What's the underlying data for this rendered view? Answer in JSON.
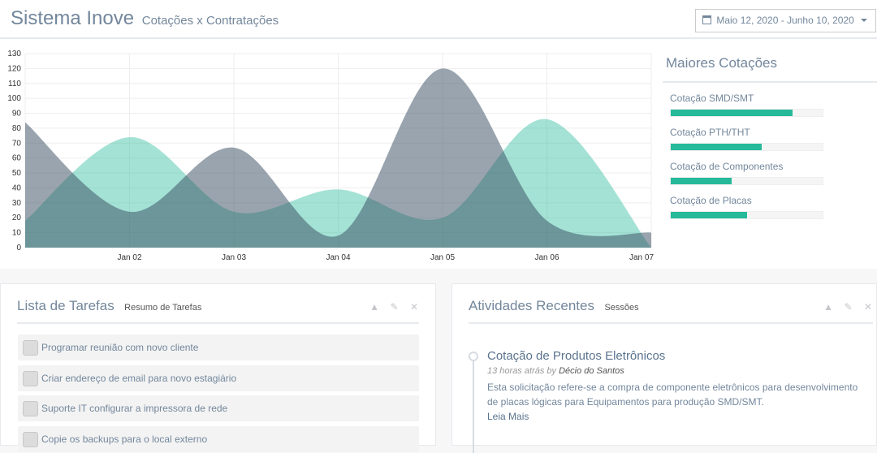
{
  "header": {
    "title": "Sistema Inove",
    "subtitle": "Cotações x Contratações",
    "daterange": "Maio 12, 2020 - Junho 10, 2020",
    "calendar_icon": "calendar-icon",
    "caret_icon": "caret-down-icon"
  },
  "chart_data": {
    "type": "area",
    "xlabels": [
      "Jan 02",
      "Jan 03",
      "Jan 04",
      "Jan 05",
      "Jan 06",
      "Jan 07"
    ],
    "ylim": [
      0,
      130
    ],
    "yticks": [
      0,
      10,
      20,
      30,
      40,
      50,
      60,
      70,
      80,
      90,
      100,
      110,
      120,
      130
    ],
    "grid": true,
    "series": [
      {
        "color": "#26b99a",
        "points": [
          [
            1,
            18
          ],
          [
            2,
            74
          ],
          [
            3,
            24
          ],
          [
            4,
            39
          ],
          [
            5,
            20
          ],
          [
            6,
            86
          ],
          [
            7,
            0
          ]
        ]
      },
      {
        "color": "#34495e",
        "points": [
          [
            1,
            84
          ],
          [
            2,
            24
          ],
          [
            3,
            67
          ],
          [
            4,
            8
          ],
          [
            5,
            120
          ],
          [
            6,
            18
          ],
          [
            7,
            10
          ]
        ]
      }
    ]
  },
  "sidebar": {
    "title": "Maiores Cotações",
    "items": [
      {
        "label": "Cotação SMD/SMT",
        "value": 80
      },
      {
        "label": "Cotação PTH/THT",
        "value": 60
      },
      {
        "label": "Cotação de Componentes",
        "value": 40
      },
      {
        "label": "Cotação de Placas",
        "value": 50
      }
    ]
  },
  "tasks": {
    "title": "Lista de Tarefas",
    "subtitle": "Resumo de Tarefas",
    "items": [
      "Programar reunião com novo cliente",
      "Criar endereço de email para novo estagiário",
      "Suporte IT configurar a impressora de rede",
      "Copie os backups para o local externo"
    ]
  },
  "activities": {
    "title": "Atividades Recentes",
    "subtitle": "Sessões",
    "item": {
      "title": "Cotação de Produtos Eletrônicos",
      "time": "13 horas atrás by",
      "author": "Décio do Santos",
      "body": "Esta solicitação refere-se a compra de componente eletrônicos para desenvolvimento de placas lógicas para Equipamentos para produção SMD/SMT.",
      "more": "Leia Mais"
    }
  },
  "panel_tools": {
    "collapse": "▲",
    "wrench": "✎",
    "close": "✕"
  }
}
